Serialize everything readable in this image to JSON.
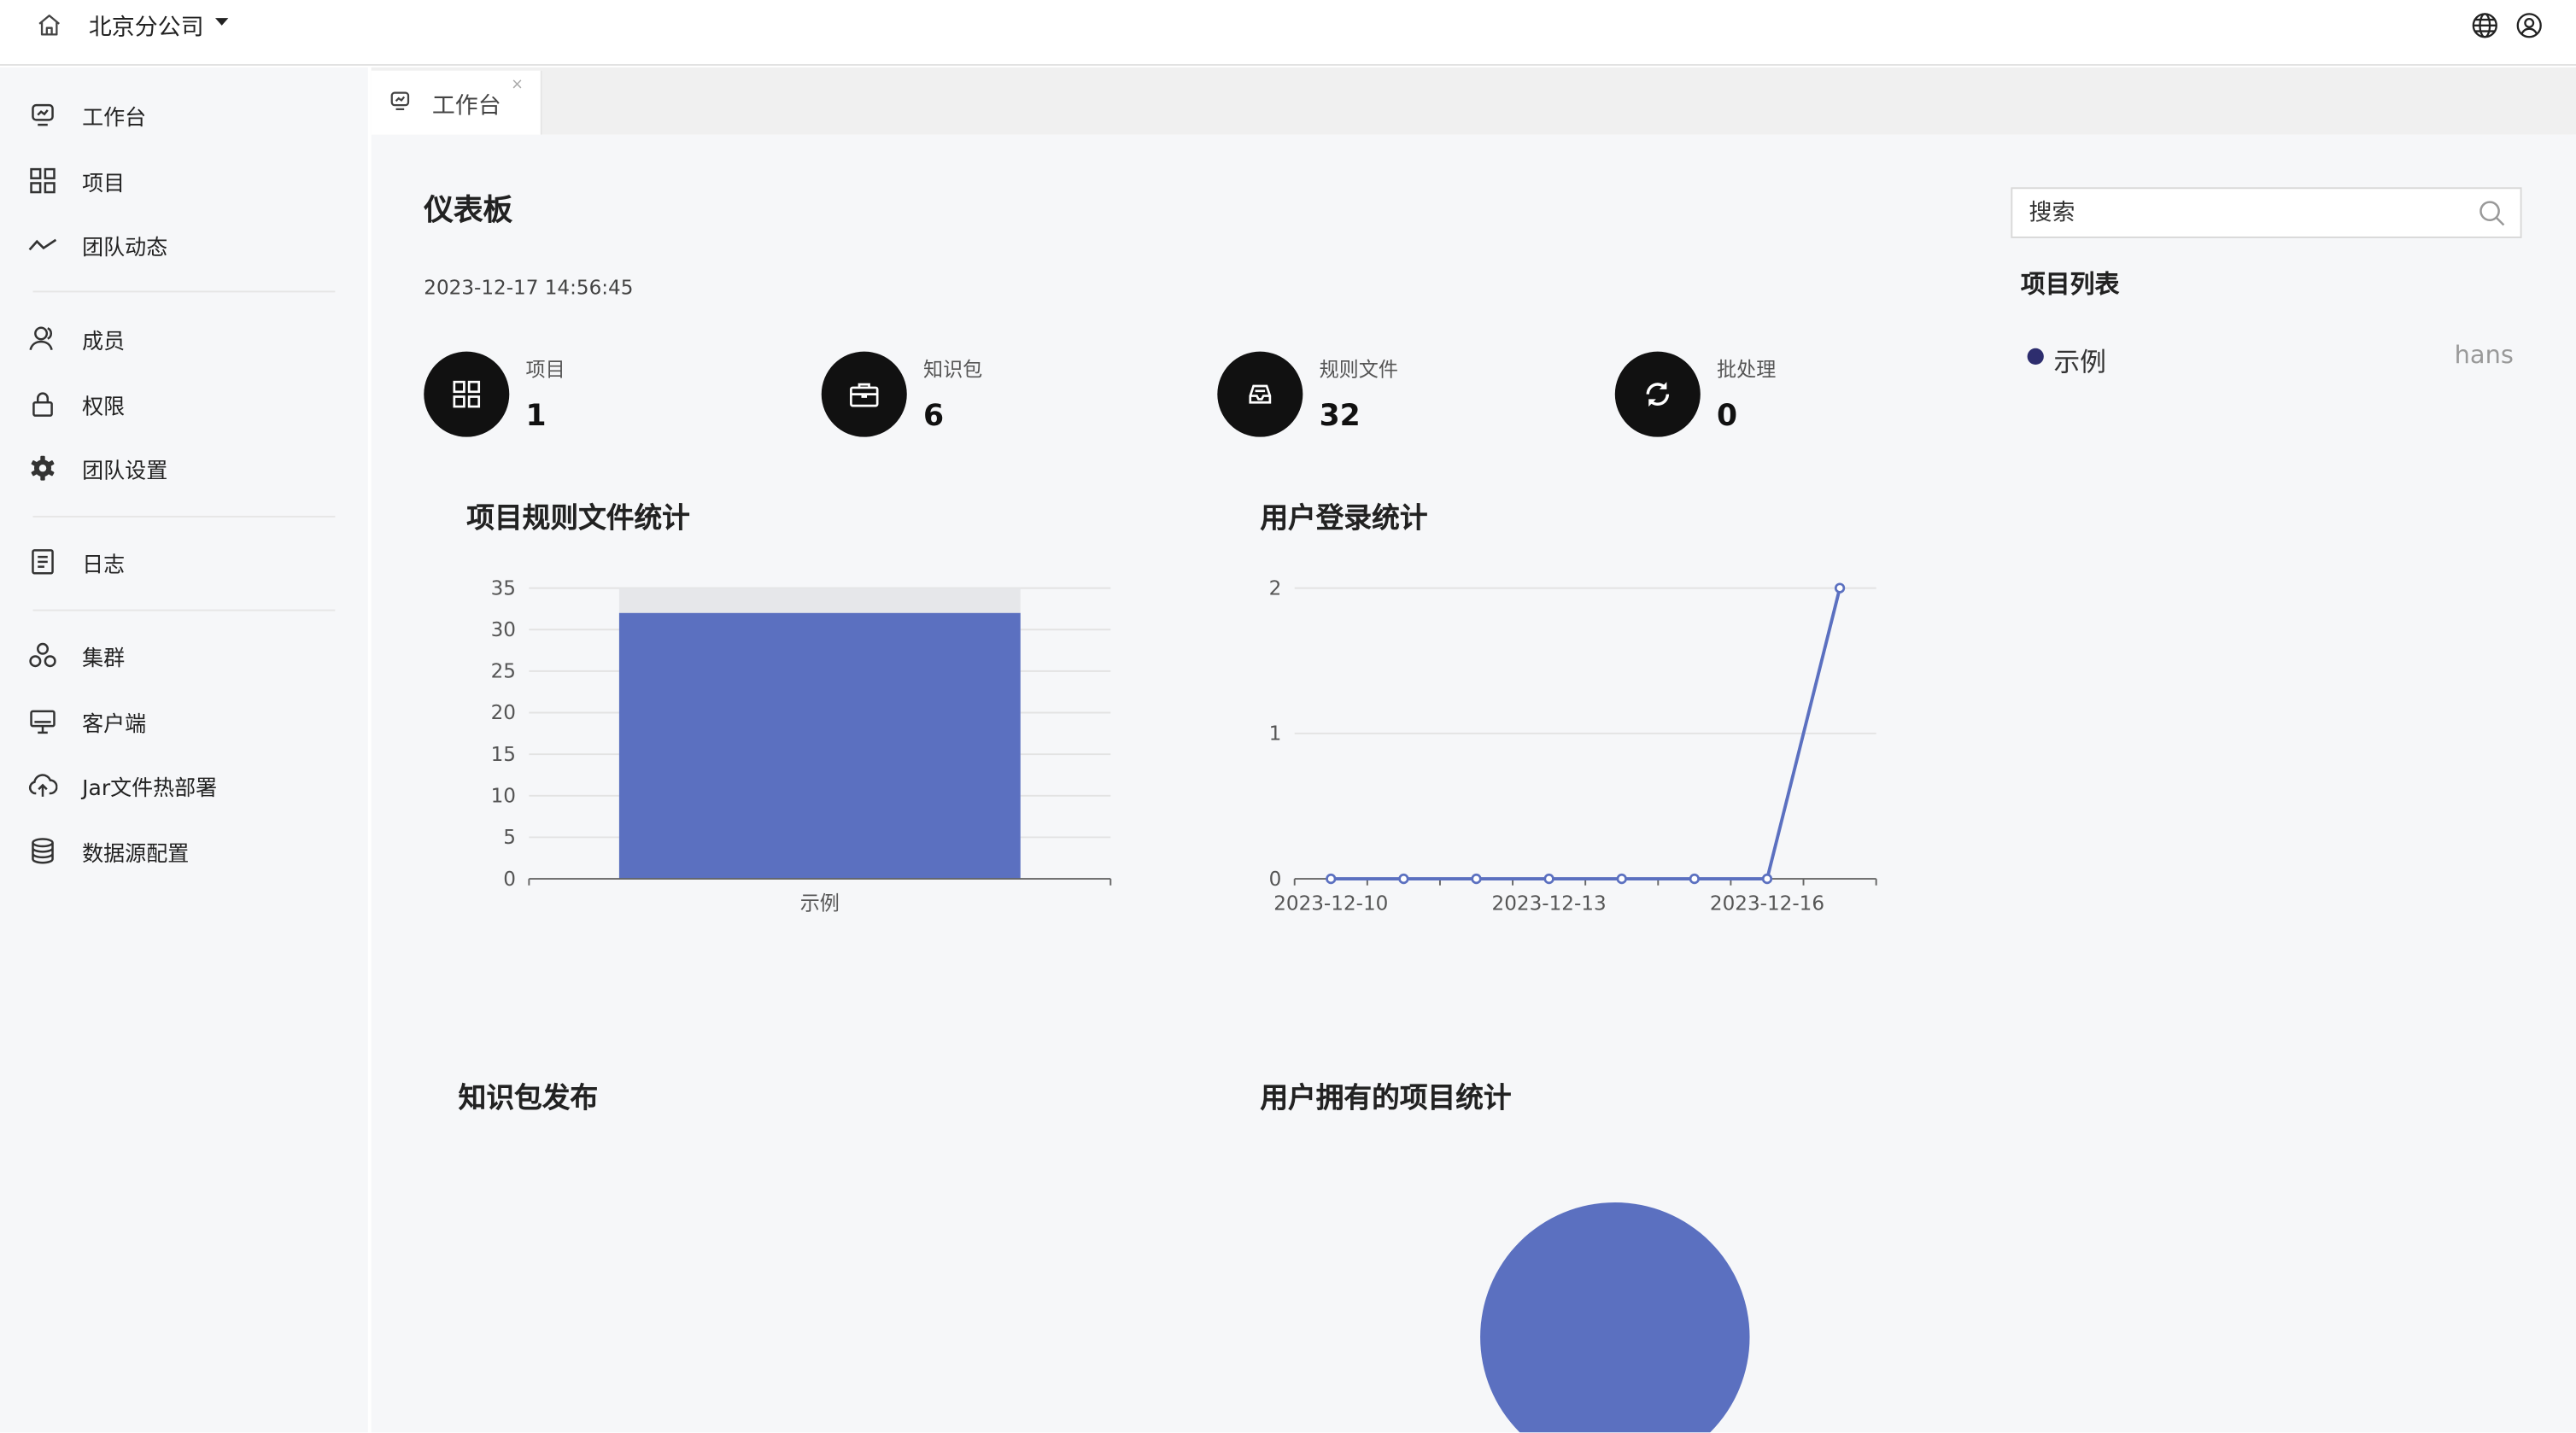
{
  "topbar": {
    "org_name": "北京分公司"
  },
  "sidebar": {
    "items": [
      {
        "label": "工作台",
        "icon": "dashboard-icon"
      },
      {
        "label": "项目",
        "icon": "grid-icon"
      },
      {
        "label": "团队动态",
        "icon": "activity-icon"
      },
      {
        "label": "成员",
        "icon": "members-icon"
      },
      {
        "label": "权限",
        "icon": "lock-icon"
      },
      {
        "label": "团队设置",
        "icon": "gear-icon"
      },
      {
        "label": "日志",
        "icon": "log-icon"
      },
      {
        "label": "集群",
        "icon": "cluster-icon"
      },
      {
        "label": "客户端",
        "icon": "monitor-icon"
      },
      {
        "label": "Jar文件热部署",
        "icon": "cloud-upload-icon"
      },
      {
        "label": "数据源配置",
        "icon": "database-icon"
      }
    ]
  },
  "tabs": [
    {
      "label": "工作台",
      "close": "×"
    }
  ],
  "dashboard": {
    "title": "仪表板",
    "timestamp": "2023-12-17 14:56:45",
    "stats": [
      {
        "label": "项目",
        "value": "1",
        "icon": "grid-icon"
      },
      {
        "label": "知识包",
        "value": "6",
        "icon": "briefcase-icon"
      },
      {
        "label": "规则文件",
        "value": "32",
        "icon": "inbox-icon"
      },
      {
        "label": "批处理",
        "value": "0",
        "icon": "refresh-icon"
      }
    ],
    "panel_titles": {
      "rule_files": "项目规则文件统计",
      "user_login": "用户登录统计",
      "package_publish": "知识包发布",
      "user_projects": "用户拥有的项目统计"
    }
  },
  "right_panel": {
    "search_placeholder": "搜索",
    "list_title": "项目列表",
    "projects": [
      {
        "name": "示例",
        "owner": "hans"
      }
    ]
  },
  "colors": {
    "series": "#5b70c0",
    "dot": "#2d2d6e"
  },
  "chart_data": [
    {
      "type": "bar",
      "title": "项目规则文件统计",
      "categories": [
        "示例"
      ],
      "values": [
        32
      ],
      "ylim": [
        0,
        35
      ],
      "yticks": [
        "0",
        "5",
        "10",
        "15",
        "20",
        "25",
        "30",
        "35"
      ]
    },
    {
      "type": "line",
      "title": "用户登录统计",
      "x": [
        "2023-12-10",
        "2023-12-11",
        "2023-12-12",
        "2023-12-13",
        "2023-12-14",
        "2023-12-15",
        "2023-12-16",
        "2023-12-17"
      ],
      "values": [
        0,
        0,
        0,
        0,
        0,
        0,
        0,
        2
      ],
      "xtick_labels": [
        "2023-12-10",
        "2023-12-13",
        "2023-12-16"
      ],
      "ylim": [
        0,
        2
      ],
      "yticks": [
        "0",
        "1",
        "2"
      ]
    },
    {
      "type": "pie",
      "title": "用户拥有的项目统计",
      "categories": [
        "hans"
      ],
      "values": [
        1
      ]
    }
  ]
}
